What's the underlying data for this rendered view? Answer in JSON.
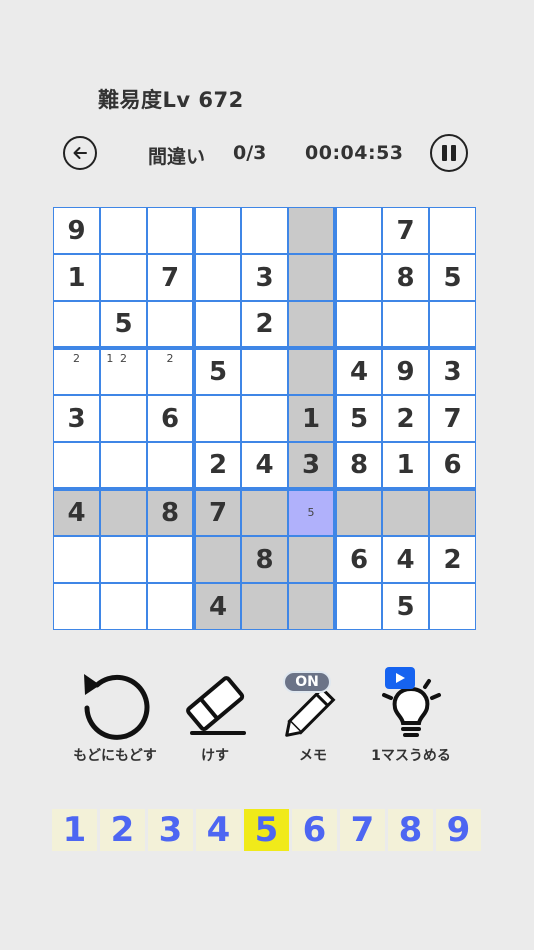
{
  "header": {
    "level": "難易度Lv 672"
  },
  "status": {
    "mistakes_label": "間違い",
    "mistakes_value": "0/3",
    "timer": "00:04:53"
  },
  "board": {
    "cells": [
      [
        "9",
        "",
        "",
        "",
        "",
        "",
        "",
        "7",
        ""
      ],
      [
        "1",
        "",
        "7",
        "",
        "3",
        "",
        "",
        "8",
        "5"
      ],
      [
        "",
        "5",
        "",
        "",
        "2",
        "",
        "",
        "",
        ""
      ],
      [
        "",
        "",
        "",
        "5",
        "",
        "",
        "4",
        "9",
        "3"
      ],
      [
        "3",
        "",
        "6",
        "",
        "",
        "1",
        "5",
        "2",
        "7"
      ],
      [
        "",
        "",
        "",
        "2",
        "4",
        "3",
        "8",
        "1",
        "6"
      ],
      [
        "4",
        "",
        "8",
        "7",
        "",
        "",
        "",
        "",
        ""
      ],
      [
        "",
        "",
        "",
        "",
        "8",
        "",
        "6",
        "4",
        "2"
      ],
      [
        "",
        "",
        "",
        "4",
        "",
        "",
        "",
        "5",
        ""
      ]
    ],
    "highlighted": [
      [
        0,
        5
      ],
      [
        1,
        5
      ],
      [
        2,
        5
      ],
      [
        3,
        5
      ],
      [
        4,
        5
      ],
      [
        5,
        5
      ],
      [
        7,
        5
      ],
      [
        8,
        5
      ],
      [
        6,
        0
      ],
      [
        6,
        1
      ],
      [
        6,
        2
      ],
      [
        6,
        3
      ],
      [
        6,
        4
      ],
      [
        6,
        6
      ],
      [
        6,
        7
      ],
      [
        6,
        8
      ],
      [
        7,
        3
      ],
      [
        7,
        4
      ],
      [
        8,
        3
      ],
      [
        8,
        4
      ]
    ],
    "selected": [
      6,
      5
    ],
    "memos": [
      {
        "row": 3,
        "col": 0,
        "notes": [
          "2"
        ]
      },
      {
        "row": 3,
        "col": 1,
        "notes": [
          "1",
          "2"
        ]
      },
      {
        "row": 3,
        "col": 2,
        "notes": [
          "2"
        ]
      },
      {
        "row": 6,
        "col": 5,
        "notes": [
          "5"
        ]
      }
    ]
  },
  "tools": {
    "undo_label": "もどにもどす",
    "erase_label": "けす",
    "memo_label": "メモ",
    "memo_badge": "ON",
    "hint_label": "1マスうめる"
  },
  "numpad": {
    "keys": [
      "1",
      "2",
      "3",
      "4",
      "5",
      "6",
      "7",
      "8",
      "9"
    ],
    "active": "5"
  },
  "colors": {
    "grid": "#3f86e6",
    "highlight": "#c9c9c9",
    "selected": "#b0b1fb",
    "numpad_bg": "#f3f1d8",
    "numpad_active": "#f0ea1a",
    "numpad_text": "#4d66f2"
  }
}
